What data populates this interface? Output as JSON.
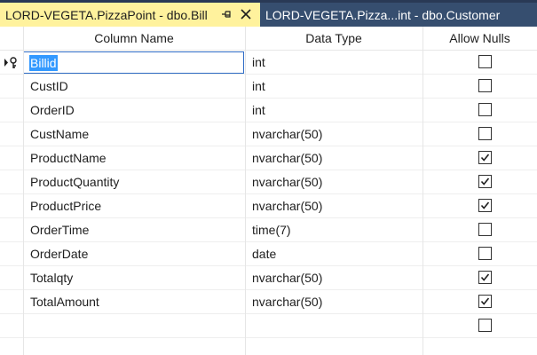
{
  "tabs": [
    {
      "title": "LORD-VEGETA.PizzaPoint - dbo.Bill",
      "active": true
    },
    {
      "title": "LORD-VEGETA.Pizza...int - dbo.Customer",
      "active": false
    }
  ],
  "headers": {
    "name": "Column Name",
    "type": "Data Type",
    "nulls": "Allow Nulls"
  },
  "rows": [
    {
      "name": "Billid",
      "type": "int",
      "allow_nulls": false,
      "primary_key": true,
      "editing": true
    },
    {
      "name": "CustID",
      "type": "int",
      "allow_nulls": false
    },
    {
      "name": "OrderID",
      "type": "int",
      "allow_nulls": false
    },
    {
      "name": "CustName",
      "type": "nvarchar(50)",
      "allow_nulls": false
    },
    {
      "name": "ProductName",
      "type": "nvarchar(50)",
      "allow_nulls": true
    },
    {
      "name": "ProductQuantity",
      "type": "nvarchar(50)",
      "allow_nulls": true
    },
    {
      "name": "ProductPrice",
      "type": "nvarchar(50)",
      "allow_nulls": true
    },
    {
      "name": "OrderTime",
      "type": "time(7)",
      "allow_nulls": false
    },
    {
      "name": "OrderDate",
      "type": "date",
      "allow_nulls": false
    },
    {
      "name": "Totalqty",
      "type": "nvarchar(50)",
      "allow_nulls": true
    },
    {
      "name": "TotalAmount",
      "type": "nvarchar(50)",
      "allow_nulls": true
    },
    {
      "name": "",
      "type": "",
      "allow_nulls": false
    }
  ],
  "colors": {
    "active_tab": "#fff29d",
    "tabstrip": "#293955",
    "selection": "#3399ff",
    "edit_border": "#2e6bc5"
  },
  "icons": {
    "pin": "pin-icon",
    "close": "close-icon",
    "key": "primary-key-icon"
  }
}
